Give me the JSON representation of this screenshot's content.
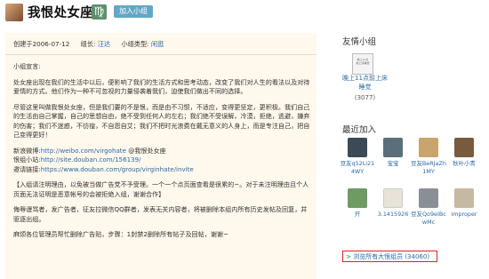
{
  "header": {
    "title": "我恨处女座",
    "zodiac_symbol": "♍",
    "join_button": "加入小组"
  },
  "meta": {
    "created": "创建于2006-07-12",
    "leader_label": "组长:",
    "leader_name": "汪达",
    "type_label": "小组类型:",
    "type_value": "闲逛"
  },
  "main": {
    "heading": "小组宣言:",
    "para1": "处女座出现在我们的生活中以后，便影响了我们的生活方式和思考动态，改变了我们对人生的看法以及对待爱情的方式。他们作为一种不可忽视的力量侵袭着我们，迫使我们做出不同的选择。",
    "para2": "尽管这里叫做我恨处女座，但是我们要的不是恨，而是由不习惯，不适应，变得更坚定，更积极。我们自己的生活由自己掌握，自己的思想自由，绝不受到任何人的左右；我们绝不受误解，冷漠，拒绝，逃避，嫌弃的伤害；我们不迷惑，不彷徨，不自怨自艾；我们不把时光浪费在戴无意义的人身上，而是专注自己，把自己变得更好！",
    "weibo_label": "新浪微博:",
    "weibo_url": "http://weibo.com/virgohate",
    "weibo_handle": "@我恨处女座",
    "site_label": "恨组小站:",
    "site_url": "http://site.douban.com/156139/",
    "invite_label": "邀请链接:",
    "invite_url": "https://www.douban.com/group/virginhate/invite",
    "rule1": "【入组请注明理由，以免被当做广告党不予受理。一个一个点页面查看是很累的~。对于未注明理由且个人页面无法证明是恶意帐号的会被拒绝入组，谢谢合作】",
    "rule2": "侮辱谩骂者，发广告者，征友拉微信QQ群者，发表无关内容者，将被删除本组内所有历史发帖及回复，并驱逐出组。",
    "rule3": "麻烦各位管理员帮忙删除广告贴，步骤：1封禁2删除所有帖子及回帖，谢谢~"
  },
  "sidebar": {
    "friends_title": "友情小组",
    "friend_name": "晚上11点前上床睡觉",
    "friend_count": "(3077)",
    "recent_title": "最近加入",
    "members": [
      {
        "name": "豆友q52Li214WY",
        "color": "#3b4a56"
      },
      {
        "name": "宝宝",
        "color": "#5a6f7a"
      },
      {
        "name": "豆友BeRJaZh1MY",
        "color": "#c9a46c"
      },
      {
        "name": "秋叶小青",
        "color": "#7a5a3e"
      },
      {
        "name": "开",
        "color": "#6f9a63"
      },
      {
        "name": "3.1415926",
        "color": "#e8e3d6"
      },
      {
        "name": "豆友Qo9eIBcwMc",
        "color": "#8a8f95"
      },
      {
        "name": "improper",
        "color": "#c7b8a4"
      }
    ],
    "browse_link": "> 浏览所有大恨组员 (34060)"
  }
}
